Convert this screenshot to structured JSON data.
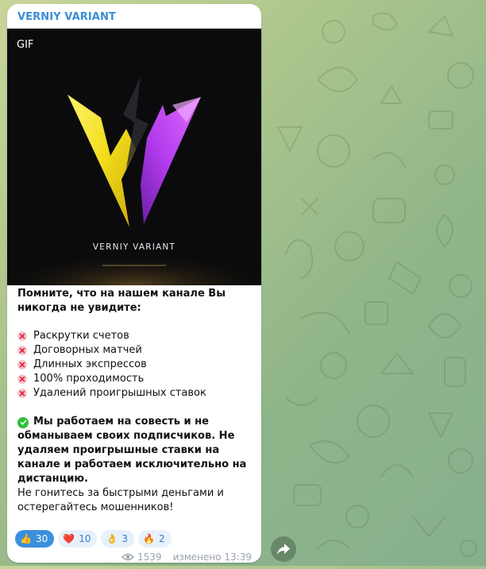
{
  "post": {
    "channel_name": "VERNIY VARIANT",
    "media": {
      "badge": "GIF",
      "logo_caption": "VERNIY VARIANT"
    },
    "intro": "Помните, что на нашем канале Вы никогда не увидите:",
    "never_list": [
      "Раскрутки счетов",
      "Договорных матчей",
      "Длинных экспрессов",
      "100% проходимость",
      "Удалений проигрышных ставок"
    ],
    "honesty_text": "Мы работаем на совесть и не обманываем своих подписчиков. Не удаляем проигрышные ставки на канале и работаем исключительно на дистанцию.",
    "warning_text": "Не гонитесь за быстрыми деньгами и остерегайтесь мошенников!",
    "reactions": [
      {
        "icon": "thumbs-up-icon",
        "emoji": "👍",
        "count": "30"
      },
      {
        "icon": "heart-icon",
        "emoji": "❤️",
        "count": "10"
      },
      {
        "icon": "ok-hand-icon",
        "emoji": "👌",
        "count": "3"
      },
      {
        "icon": "fire-icon",
        "emoji": "🔥",
        "count": "2"
      }
    ],
    "views": "1539",
    "edited_label": "изменено 13:39"
  },
  "colors": {
    "channel_name": "#3a8ed6",
    "reaction_active_bg": "#3a90dd",
    "reaction_bg": "#e7f1fb",
    "logo_yellow": "#f3e21a",
    "logo_purple": "#b53cf0"
  }
}
